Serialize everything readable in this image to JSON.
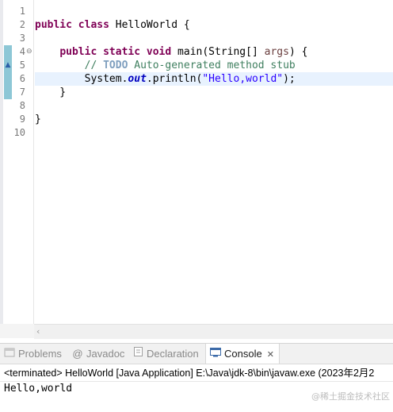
{
  "editor": {
    "line_numbers": [
      "1",
      "2",
      "3",
      "4",
      "5",
      "6",
      "7",
      "8",
      "9",
      "10"
    ],
    "fold_marker_icon": "collapse-minus-icon",
    "override_marker_icon": "override-triangle-icon",
    "lines": [
      {
        "parts": []
      },
      {
        "parts": [
          [
            "kw",
            "public"
          ],
          [
            "",
            "  "
          ],
          [
            "kw",
            "class"
          ],
          [
            "",
            ""
          ],
          " HelloWorld {"
        ]
      },
      {
        "parts": []
      },
      {
        "parts": []
      },
      {
        "parts": []
      },
      {
        "parts": []
      },
      {
        "parts": []
      },
      {
        "parts": []
      },
      {
        "parts": []
      },
      {
        "parts": []
      }
    ],
    "code": {
      "l2_kw1": "public",
      "l2_kw2": "class",
      "l2_rest": " HelloWorld {",
      "l4_indent": "    ",
      "l4_kw1": "public",
      "l4_kw2": "static",
      "l4_kw3": "void",
      "l4_rest1": " main(String[] ",
      "l4_param": "args",
      "l4_rest2": ") {",
      "l5_indent": "        ",
      "l5_comment_start": "// ",
      "l5_todo": "TODO",
      "l5_comment_rest": " Auto-generated method stub",
      "l6_indent": "        ",
      "l6_a": "System.",
      "l6_field": "out",
      "l6_b": ".println(",
      "l6_string": "\"Hello,world\"",
      "l6_c": ");",
      "l7": "    }",
      "l9": "}"
    },
    "scroll_left_icon": "scroll-left-arrow-icon",
    "current_line": 6
  },
  "panel": {
    "tabs": [
      {
        "label": "Problems",
        "icon": "problems-icon",
        "active": false
      },
      {
        "label": "Javadoc",
        "icon": "at-sign-icon",
        "active": false
      },
      {
        "label": "Declaration",
        "icon": "declaration-icon",
        "active": false
      },
      {
        "label": "Console",
        "icon": "console-icon",
        "active": true
      }
    ],
    "console_close_icon": "close-icon",
    "console_info": "<terminated> HelloWorld [Java Application] E:\\Java\\jdk-8\\bin\\javaw.exe  (2023年2月2",
    "console_output": "Hello,world",
    "watermark": "@稀土掘金技术社区"
  }
}
